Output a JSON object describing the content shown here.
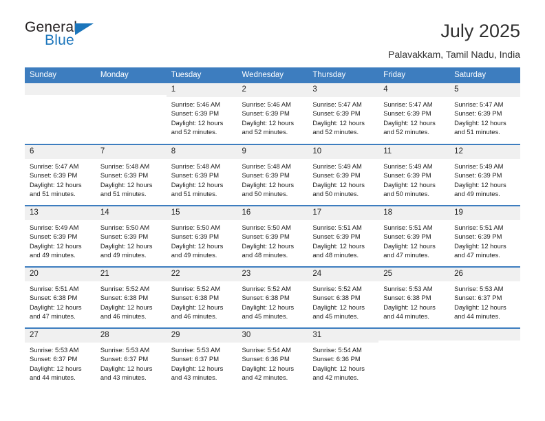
{
  "brand": {
    "name_part1": "General",
    "name_part2": "Blue",
    "triangle_color": "#1b75bb",
    "text_color": "#231f20"
  },
  "header": {
    "title": "July 2025",
    "subtitle": "Palavakkam, Tamil Nadu, India"
  },
  "theme": {
    "header_blue": "#3d7dbf",
    "daynum_gray": "#f0f0f0",
    "text": "#1a1a1a"
  },
  "weekdays": [
    "Sunday",
    "Monday",
    "Tuesday",
    "Wednesday",
    "Thursday",
    "Friday",
    "Saturday"
  ],
  "weeks": [
    [
      {
        "day": "",
        "lines": []
      },
      {
        "day": "",
        "lines": []
      },
      {
        "day": "1",
        "lines": [
          "Sunrise: 5:46 AM",
          "Sunset: 6:39 PM",
          "Daylight: 12 hours",
          "and 52 minutes."
        ]
      },
      {
        "day": "2",
        "lines": [
          "Sunrise: 5:46 AM",
          "Sunset: 6:39 PM",
          "Daylight: 12 hours",
          "and 52 minutes."
        ]
      },
      {
        "day": "3",
        "lines": [
          "Sunrise: 5:47 AM",
          "Sunset: 6:39 PM",
          "Daylight: 12 hours",
          "and 52 minutes."
        ]
      },
      {
        "day": "4",
        "lines": [
          "Sunrise: 5:47 AM",
          "Sunset: 6:39 PM",
          "Daylight: 12 hours",
          "and 52 minutes."
        ]
      },
      {
        "day": "5",
        "lines": [
          "Sunrise: 5:47 AM",
          "Sunset: 6:39 PM",
          "Daylight: 12 hours",
          "and 51 minutes."
        ]
      }
    ],
    [
      {
        "day": "6",
        "lines": [
          "Sunrise: 5:47 AM",
          "Sunset: 6:39 PM",
          "Daylight: 12 hours",
          "and 51 minutes."
        ]
      },
      {
        "day": "7",
        "lines": [
          "Sunrise: 5:48 AM",
          "Sunset: 6:39 PM",
          "Daylight: 12 hours",
          "and 51 minutes."
        ]
      },
      {
        "day": "8",
        "lines": [
          "Sunrise: 5:48 AM",
          "Sunset: 6:39 PM",
          "Daylight: 12 hours",
          "and 51 minutes."
        ]
      },
      {
        "day": "9",
        "lines": [
          "Sunrise: 5:48 AM",
          "Sunset: 6:39 PM",
          "Daylight: 12 hours",
          "and 50 minutes."
        ]
      },
      {
        "day": "10",
        "lines": [
          "Sunrise: 5:49 AM",
          "Sunset: 6:39 PM",
          "Daylight: 12 hours",
          "and 50 minutes."
        ]
      },
      {
        "day": "11",
        "lines": [
          "Sunrise: 5:49 AM",
          "Sunset: 6:39 PM",
          "Daylight: 12 hours",
          "and 50 minutes."
        ]
      },
      {
        "day": "12",
        "lines": [
          "Sunrise: 5:49 AM",
          "Sunset: 6:39 PM",
          "Daylight: 12 hours",
          "and 49 minutes."
        ]
      }
    ],
    [
      {
        "day": "13",
        "lines": [
          "Sunrise: 5:49 AM",
          "Sunset: 6:39 PM",
          "Daylight: 12 hours",
          "and 49 minutes."
        ]
      },
      {
        "day": "14",
        "lines": [
          "Sunrise: 5:50 AM",
          "Sunset: 6:39 PM",
          "Daylight: 12 hours",
          "and 49 minutes."
        ]
      },
      {
        "day": "15",
        "lines": [
          "Sunrise: 5:50 AM",
          "Sunset: 6:39 PM",
          "Daylight: 12 hours",
          "and 49 minutes."
        ]
      },
      {
        "day": "16",
        "lines": [
          "Sunrise: 5:50 AM",
          "Sunset: 6:39 PM",
          "Daylight: 12 hours",
          "and 48 minutes."
        ]
      },
      {
        "day": "17",
        "lines": [
          "Sunrise: 5:51 AM",
          "Sunset: 6:39 PM",
          "Daylight: 12 hours",
          "and 48 minutes."
        ]
      },
      {
        "day": "18",
        "lines": [
          "Sunrise: 5:51 AM",
          "Sunset: 6:39 PM",
          "Daylight: 12 hours",
          "and 47 minutes."
        ]
      },
      {
        "day": "19",
        "lines": [
          "Sunrise: 5:51 AM",
          "Sunset: 6:39 PM",
          "Daylight: 12 hours",
          "and 47 minutes."
        ]
      }
    ],
    [
      {
        "day": "20",
        "lines": [
          "Sunrise: 5:51 AM",
          "Sunset: 6:38 PM",
          "Daylight: 12 hours",
          "and 47 minutes."
        ]
      },
      {
        "day": "21",
        "lines": [
          "Sunrise: 5:52 AM",
          "Sunset: 6:38 PM",
          "Daylight: 12 hours",
          "and 46 minutes."
        ]
      },
      {
        "day": "22",
        "lines": [
          "Sunrise: 5:52 AM",
          "Sunset: 6:38 PM",
          "Daylight: 12 hours",
          "and 46 minutes."
        ]
      },
      {
        "day": "23",
        "lines": [
          "Sunrise: 5:52 AM",
          "Sunset: 6:38 PM",
          "Daylight: 12 hours",
          "and 45 minutes."
        ]
      },
      {
        "day": "24",
        "lines": [
          "Sunrise: 5:52 AM",
          "Sunset: 6:38 PM",
          "Daylight: 12 hours",
          "and 45 minutes."
        ]
      },
      {
        "day": "25",
        "lines": [
          "Sunrise: 5:53 AM",
          "Sunset: 6:38 PM",
          "Daylight: 12 hours",
          "and 44 minutes."
        ]
      },
      {
        "day": "26",
        "lines": [
          "Sunrise: 5:53 AM",
          "Sunset: 6:37 PM",
          "Daylight: 12 hours",
          "and 44 minutes."
        ]
      }
    ],
    [
      {
        "day": "27",
        "lines": [
          "Sunrise: 5:53 AM",
          "Sunset: 6:37 PM",
          "Daylight: 12 hours",
          "and 44 minutes."
        ]
      },
      {
        "day": "28",
        "lines": [
          "Sunrise: 5:53 AM",
          "Sunset: 6:37 PM",
          "Daylight: 12 hours",
          "and 43 minutes."
        ]
      },
      {
        "day": "29",
        "lines": [
          "Sunrise: 5:53 AM",
          "Sunset: 6:37 PM",
          "Daylight: 12 hours",
          "and 43 minutes."
        ]
      },
      {
        "day": "30",
        "lines": [
          "Sunrise: 5:54 AM",
          "Sunset: 6:36 PM",
          "Daylight: 12 hours",
          "and 42 minutes."
        ]
      },
      {
        "day": "31",
        "lines": [
          "Sunrise: 5:54 AM",
          "Sunset: 6:36 PM",
          "Daylight: 12 hours",
          "and 42 minutes."
        ]
      },
      {
        "day": "",
        "lines": []
      },
      {
        "day": "",
        "lines": []
      }
    ]
  ]
}
